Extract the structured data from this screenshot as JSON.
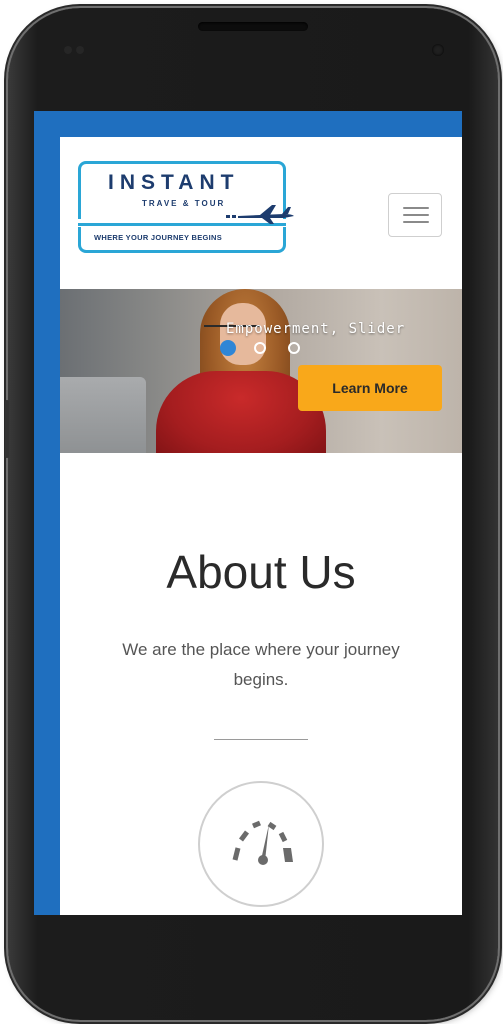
{
  "logo": {
    "name": "INSTANT",
    "sub": "TRAVE & TOUR",
    "tagline": "WHERE YOUR JOURNEY BEGINS"
  },
  "header": {
    "menu_icon": "hamburger-icon"
  },
  "hero": {
    "slide_title": "Empowerment, Slider",
    "button_label": "Learn More",
    "dots_total": 3,
    "active_dot": 1,
    "button_color": "#f9a81a"
  },
  "about": {
    "title": "About Us",
    "text": "We are the place where your journey begins.",
    "icon": "speedometer-icon"
  },
  "colors": {
    "frame_blue": "#1f6fbf",
    "logo_cyan": "#2aa6d6",
    "logo_navy": "#1d3c6e"
  }
}
